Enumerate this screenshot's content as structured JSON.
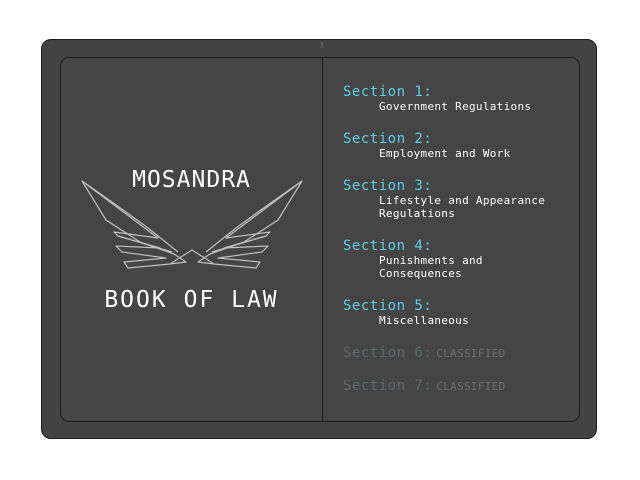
{
  "book": {
    "title_top": "MOSANDRA",
    "title_bottom": "BOOK OF LAW",
    "emblem_icon": "winged-emblem-icon"
  },
  "toc": {
    "sections": [
      {
        "heading": "Section 1:",
        "description": [
          "Government Regulations"
        ]
      },
      {
        "heading": "Section 2:",
        "description": [
          "Employment and Work"
        ]
      },
      {
        "heading": "Section 3:",
        "description": [
          "Lifestyle and Appearance",
          "Regulations"
        ]
      },
      {
        "heading": "Section 4:",
        "description": [
          "Punishments and",
          "Consequences"
        ]
      },
      {
        "heading": "Section 5:",
        "description": [
          "Miscellaneous"
        ]
      }
    ],
    "locked": [
      {
        "heading": "Section 6:",
        "tag": "CLASSIFIED"
      },
      {
        "heading": "Section 7:",
        "tag": "CLASSIFIED"
      }
    ]
  },
  "colors": {
    "section_heading": "#5ccfe6",
    "locked_heading": "#5e6a6c",
    "page": "#454545",
    "background": "#ffffff"
  }
}
